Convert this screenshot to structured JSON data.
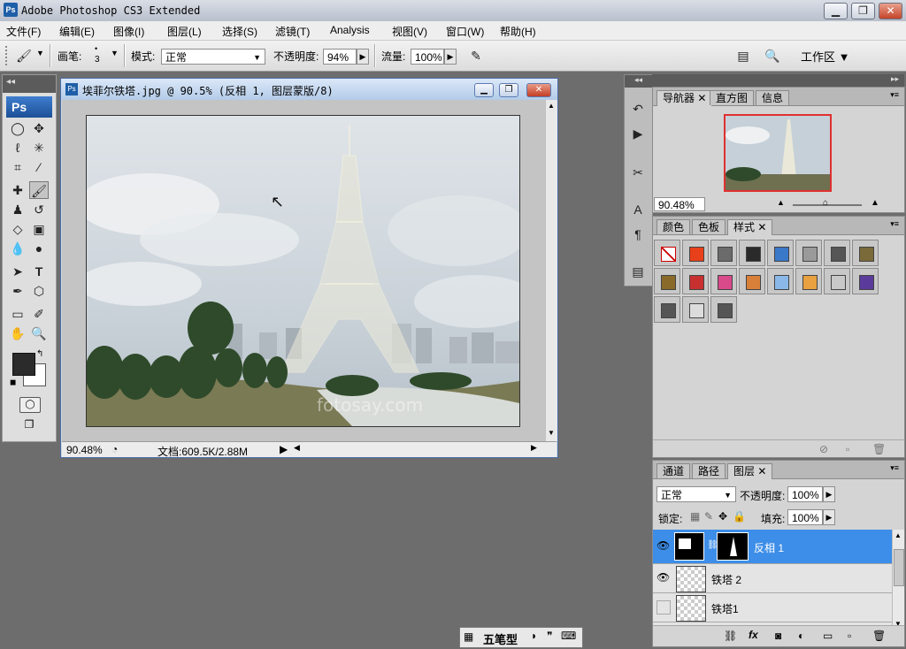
{
  "app": {
    "title": "Adobe Photoshop CS3 Extended",
    "logo": "Ps",
    "window_buttons": [
      "minimize-icon",
      "restore-icon",
      "close-icon"
    ]
  },
  "menubar": {
    "items": [
      "文件(F)",
      "编辑(E)",
      "图像(I)",
      "图层(L)",
      "选择(S)",
      "滤镜(T)",
      "Analysis",
      "视图(V)",
      "窗口(W)",
      "帮助(H)"
    ]
  },
  "options_bar": {
    "brush_label": "画笔:",
    "brush_size": "3",
    "mode_label": "模式:",
    "mode_value": "正常",
    "opacity_label": "不透明度:",
    "opacity_value": "94%",
    "flow_label": "流量:",
    "flow_value": "100%",
    "workspace_label": "工作区 ▼"
  },
  "toolbox": {
    "logo": "Ps",
    "tools": [
      "marquee-icon",
      "move-icon",
      "lasso-icon",
      "magic-wand-icon",
      "crop-icon",
      "slice-icon",
      "healing-icon",
      "brush-icon",
      "stamp-icon",
      "history-brush-icon",
      "eraser-icon",
      "gradient-icon",
      "blur-icon",
      "dodge-icon",
      "path-select-icon",
      "type-icon",
      "pen-icon",
      "shape-icon",
      "notes-icon",
      "eyedropper-icon",
      "hand-icon",
      "zoom-icon"
    ],
    "active_tool": "brush-icon"
  },
  "document": {
    "title": "埃菲尔铁塔.jpg @ 90.5% (反相 1, 图层蒙版/8)",
    "zoom": "90.48%",
    "doc_info": "文档:609.5K/2.88M",
    "watermark": "fotosay.com"
  },
  "navigator_panel": {
    "tabs": [
      "导航器",
      "直方图",
      "信息"
    ],
    "active_tab": "导航器",
    "zoom": "90.48%"
  },
  "styles_panel": {
    "tabs": [
      "颜色",
      "色板",
      "样式"
    ],
    "active_tab": "样式",
    "swatch_colors": [
      "none",
      "#e8401a",
      "#6b6b6b",
      "#2a2a2a",
      "#3a78c8",
      "#9a9a9a",
      "#555555",
      "#7a6a3a",
      "#8a6a2a",
      "#c83030",
      "#d84a8a",
      "#d8803a",
      "#8ab8e8",
      "#e8a040",
      "#c8c8c8",
      "#5a3a9a",
      "#555555",
      "#dcdcdc",
      "#555555"
    ]
  },
  "layers_panel": {
    "tabs": [
      "通道",
      "路径",
      "图层"
    ],
    "active_tab": "图层",
    "blend_mode": "正常",
    "opacity_label": "不透明度:",
    "opacity_value": "100%",
    "lock_label": "锁定:",
    "fill_label": "填充:",
    "fill_value": "100%",
    "layers": [
      {
        "name": "反相 1",
        "selected": true,
        "visible": true
      },
      {
        "name": "铁塔 2",
        "selected": false,
        "visible": true
      },
      {
        "name": "铁塔1",
        "selected": false,
        "visible": false
      }
    ]
  },
  "ime_bar": {
    "label": "五笔型"
  }
}
